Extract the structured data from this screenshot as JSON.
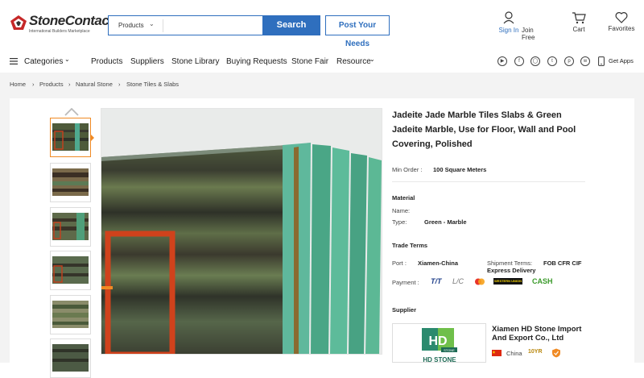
{
  "header": {
    "logo_title": "StoneContact",
    "logo_tagline": "International Builders Marketplace",
    "search_category": "Products",
    "search_placeholder": "",
    "search_button": "Search",
    "post_button": "Post Your Needs",
    "sign_in": "Sign In",
    "join_free": "Join Free",
    "cart": "Cart",
    "favorites": "Favorites"
  },
  "nav": {
    "categories": "Categories",
    "items": [
      "Products",
      "Suppliers",
      "Stone Library",
      "Buying Requests",
      "Stone Fair",
      "Resource"
    ],
    "get_apps": "Get Apps"
  },
  "breadcrumb": [
    "Home",
    "Products",
    "Natural Stone",
    "Stone Tiles & Slabs"
  ],
  "product": {
    "title": "Jadeite Jade Marble Tiles Slabs & Green Jadeite Marble, Use for Floor, Wall and Pool Covering, Polished",
    "min_order_label": "Min Order :",
    "min_order_value": "100 Square Meters",
    "material_heading": "Material",
    "name_label": "Name:",
    "type_label": "Type:",
    "type_value": "Green - Marble",
    "trade_heading": "Trade Terms",
    "port_label": "Port :",
    "port_value": "Xiamen-China",
    "shipment_label": "Shipment Terms:",
    "shipment_value": "FOB CFR CIF",
    "express": "Express Delivery",
    "payment_label": "Payment :",
    "payment_tt": "T/T",
    "payment_lc": "L/C",
    "payment_wu": "WESTERN UNION",
    "payment_cash": "CASH",
    "supplier_heading": "Supplier",
    "supplier_name": "Xiamen HD Stone Import And Export Co., Ltd",
    "supplier_country": "China",
    "supplier_years": "10YR",
    "supplier_logo_hd": "HD",
    "supplier_logo_stone": "STONE",
    "supplier_logo_text": "HD STONE"
  },
  "colors": {
    "brand_blue": "#2f6fbe",
    "accent_orange": "#f08a24",
    "cash_green": "#3a9a2a"
  }
}
